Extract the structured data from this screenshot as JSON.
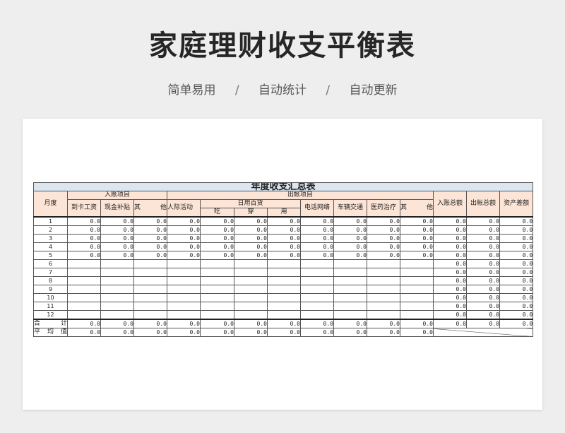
{
  "header": {
    "title": "家庭理财收支平衡表",
    "subtitle_items": [
      "简单易用",
      "自动统计",
      "自动更新"
    ],
    "subtitle_separator": "/"
  },
  "sheet": {
    "title": "年度收支汇总表",
    "col_month": "月度",
    "group_income": "入账项目",
    "group_expense": "出帐项目",
    "group_daily": "日用百货",
    "income_cols": [
      "到卡工资",
      "现金补贴",
      "其　　他"
    ],
    "expense_cols_before": "人际活动",
    "daily_cols": [
      "吃",
      "穿",
      "用"
    ],
    "expense_cols_after": [
      "电话网络",
      "车辆交通",
      "医药治疗",
      "其　　他"
    ],
    "summary_cols": [
      "入账总额",
      "出帐总额",
      "资产差额"
    ],
    "months": [
      "1",
      "2",
      "3",
      "4",
      "5",
      "6",
      "7",
      "8",
      "9",
      "10",
      "11",
      "12"
    ],
    "zero": "0.0",
    "filled_months": 5,
    "total_label": "合　计",
    "avg_label": "平均值"
  }
}
